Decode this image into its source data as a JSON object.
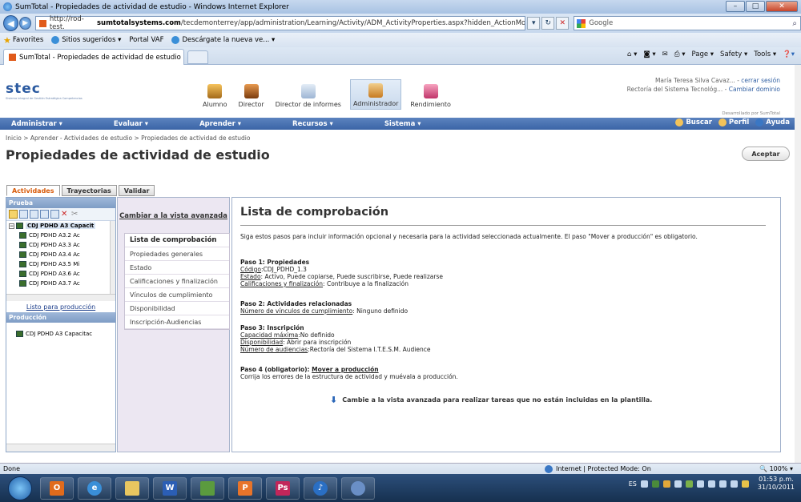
{
  "window": {
    "title": "SumTotal - Propiedades de actividad de estudio - Windows Internet Explorer",
    "url_prefix": "http://rod-test.",
    "url_domain": "sumtotalsystems.com",
    "url_rest": "/tecdemonterrey/app/administration/Learning/Activity/ADM_ActivityProperties.aspx?hidden_ActionMode=I",
    "search_label": "Google"
  },
  "favorites": {
    "label": "Favorites",
    "items": [
      "Sitios sugeridos ▾",
      "Portal VAF",
      "Descárgate la nueva ve... ▾"
    ]
  },
  "tab": {
    "title": "SumTotal - Propiedades de actividad de estudio"
  },
  "commandbar": [
    "Page ▾",
    "Safety ▾",
    "Tools ▾"
  ],
  "header": {
    "logo": "stec",
    "logo_sub": "Sistema integral de Gestión Estratégica Competencias",
    "roles": [
      "Alumno",
      "Director",
      "Director de informes",
      "Administrador",
      "Rendimiento"
    ],
    "user_name": "María Teresa Silva Cavaz...",
    "logout": "cerrar sesión",
    "org": "Rectoría del Sistema Tecnológ...",
    "change_domain": "Cambiar dominio",
    "developed_by": "Desarrollado por SumTotal"
  },
  "menu": {
    "items": [
      "Administrar ▾",
      "Evaluar ▾",
      "Aprender ▾",
      "Recursos ▾",
      "Sistema ▾"
    ],
    "right": [
      "Buscar",
      "Perfil",
      "Ayuda"
    ]
  },
  "breadcrumb": "Inicio > Aprender - Actividades de estudio > Propiedades de actividad de estudio",
  "page_title": "Propiedades de actividad de estudio",
  "accept_label": "Aceptar",
  "page_tabs": [
    "Actividades",
    "Trayectorias",
    "Validar"
  ],
  "left_panel": {
    "header": "Prueba",
    "root": "CDJ PDHD A3 Capacit",
    "children": [
      "CDJ PDHD A3.2 Ac",
      "CDJ PDHD A3.3 Ac",
      "CDJ PDHD A3.4 Ac",
      "CDJ PDHD A3.5 Mi",
      "CDJ PDHD A3.6 Ac",
      "CDJ PDHD A3.7 Ac"
    ],
    "ready_link": "Listo para producción",
    "production_header": "Producción",
    "production_item": "CDJ PDHD A3 Capacitac"
  },
  "mid_panel": {
    "switch_link": "Cambiar a la vista avanzada",
    "items": [
      "Lista de comprobación",
      "Propiedades generales",
      "Estado",
      "Calificaciones y finalización",
      "Vínculos de cumplimiento",
      "Disponibilidad",
      "Inscripción-Audiencias"
    ]
  },
  "content": {
    "title": "Lista de comprobación",
    "intro": "Siga estos pasos para incluir información opcional y necesaria para la actividad seleccionada actualmente. El paso \"Mover a producción\" es obligatorio.",
    "step1": {
      "heading": "Paso 1: Propiedades",
      "code_label": "Código",
      "code_value": ":CDJ_PDHD_1.3",
      "state_label": "Estado",
      "state_value": ": Activo, Puede copiarse, Puede suscribirse, Puede realizarse",
      "grades_label": "Calificaciones y finalización",
      "grades_value": ": Contribuye a la finalización"
    },
    "step2": {
      "heading": "Paso 2: Actividades relacionadas",
      "links_label": "Número de vínculos de cumplimiento",
      "links_value": ": Ninguno definido"
    },
    "step3": {
      "heading": "Paso 3: Inscripción",
      "capacity_label": "Capacidad máxima",
      "capacity_value": ":No definido",
      "availability_label": "Disponibilidad",
      "availability_value": ": Abrir para inscripción",
      "audiences_label": "Número de audiencias",
      "audiences_value": ":Rectoría del Sistema I.T.E.S.M. Audience"
    },
    "step4": {
      "heading": "Paso 4 (obligatorio): ",
      "move_link": "Mover a producción",
      "note": "Corrija los errores de la estructura de actividad y muévala a producción."
    },
    "advanced_note": "Cambie a la vista avanzada para realizar tareas que no están incluidas en la plantilla."
  },
  "statusbar": {
    "left": "Done",
    "zone": "Internet | Protected Mode: On",
    "zoom": "100%"
  },
  "taskbar": {
    "lang": "ES",
    "time": "01:53 p.m.",
    "date": "31/10/2011"
  }
}
